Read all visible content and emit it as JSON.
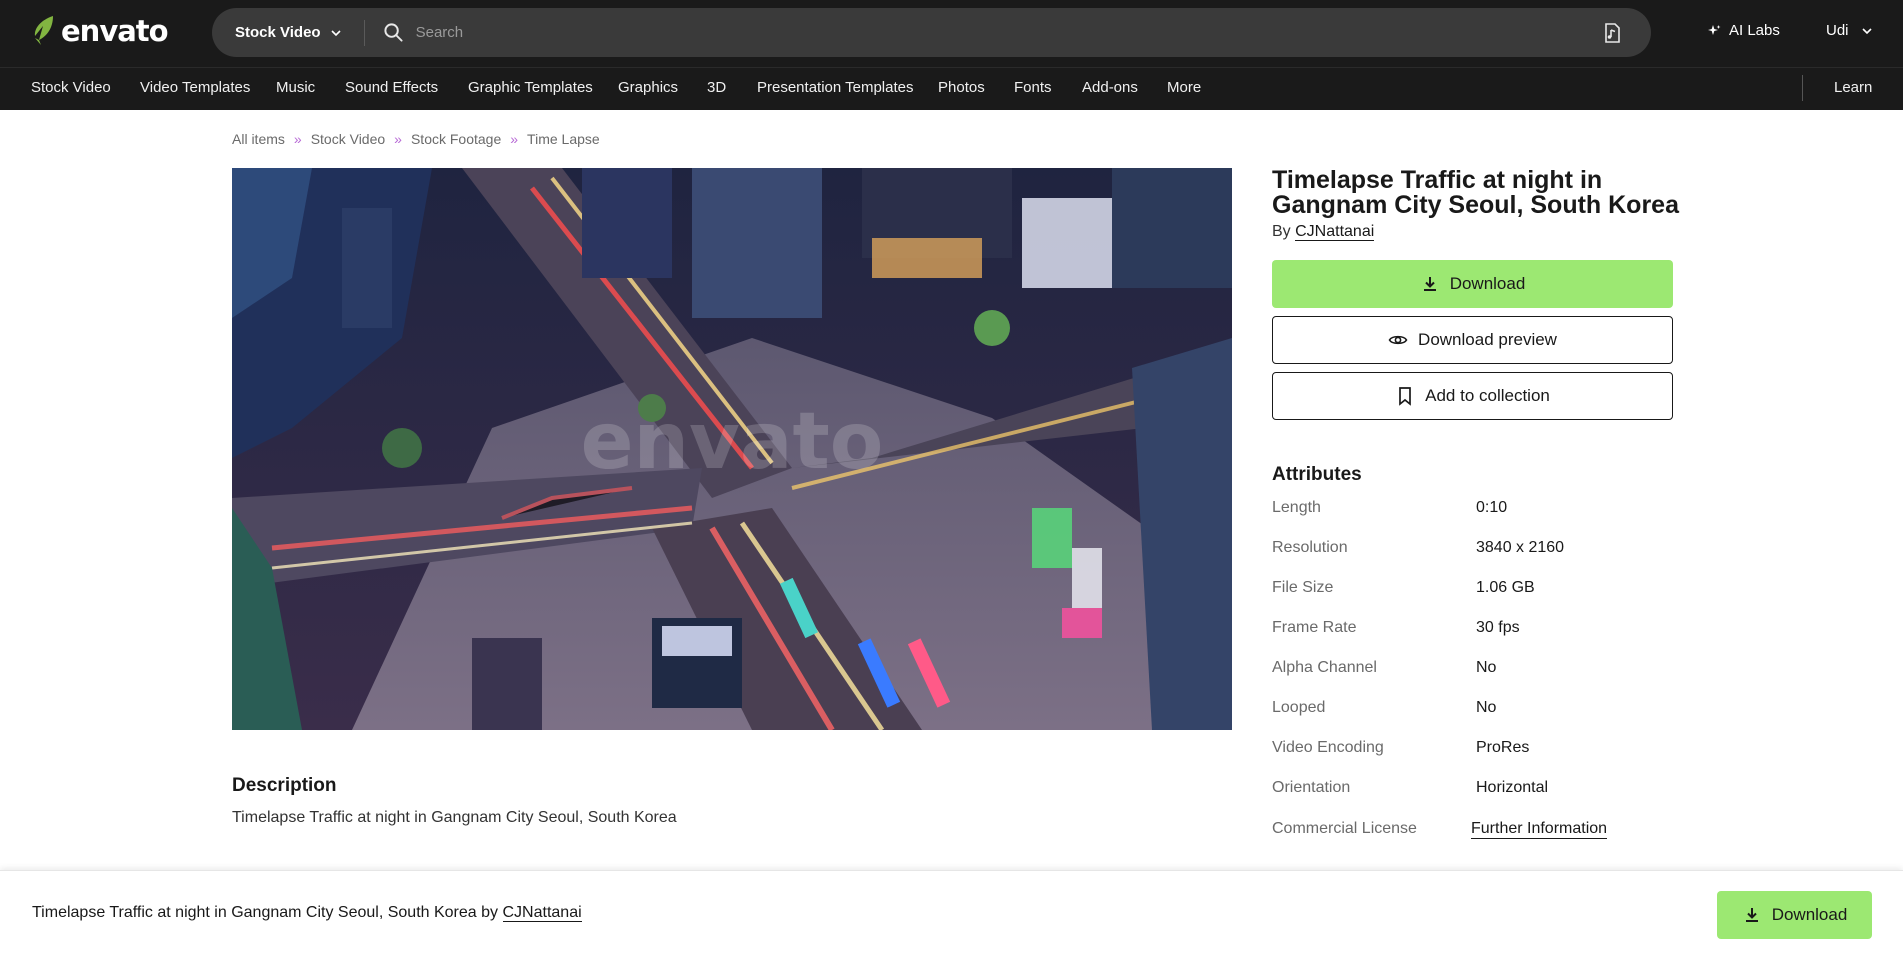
{
  "brand": {
    "name": "envato",
    "logo_icon": "envato-leaf-icon",
    "accent": "#9ce872",
    "logo_green": "#82b541"
  },
  "header": {
    "search": {
      "scope": "Stock Video",
      "placeholder": "Search"
    },
    "ai_labs": "AI Labs",
    "user": "Udi"
  },
  "categories": [
    "Stock Video",
    "Video Templates",
    "Music",
    "Sound Effects",
    "Graphic Templates",
    "Graphics",
    "3D",
    "Presentation Templates",
    "Photos",
    "Fonts",
    "Add-ons",
    "More"
  ],
  "learn": "Learn",
  "breadcrumb": [
    {
      "label": "All items"
    },
    {
      "label": "Stock Video"
    },
    {
      "label": "Stock Footage"
    },
    {
      "label": "Time Lapse"
    }
  ],
  "preview": {
    "watermark": "envato"
  },
  "item": {
    "title": "Timelapse Traffic at night in Gangnam City Seoul, South Korea",
    "by_prefix": "By",
    "author": "CJNattanai"
  },
  "actions": {
    "download": "Download",
    "download_preview": "Download preview",
    "add_to_collection": "Add to collection"
  },
  "attributes": {
    "heading": "Attributes",
    "rows": [
      {
        "label": "Length",
        "value": "0:10"
      },
      {
        "label": "Resolution",
        "value": "3840 x 2160"
      },
      {
        "label": "File Size",
        "value": "1.06 GB"
      },
      {
        "label": "Frame Rate",
        "value": "30 fps"
      },
      {
        "label": "Alpha Channel",
        "value": "No"
      },
      {
        "label": "Looped",
        "value": "No"
      },
      {
        "label": "Video Encoding",
        "value": "ProRes"
      },
      {
        "label": "Orientation",
        "value": "Horizontal"
      },
      {
        "label": "Commercial License",
        "value": "Further Information"
      }
    ]
  },
  "description": {
    "heading": "Description",
    "text": "Timelapse Traffic at night in Gangnam City Seoul, South Korea"
  },
  "sticky": {
    "title": "Timelapse Traffic at night in Gangnam City Seoul, South Korea",
    "by": "by",
    "author": "CJNattanai",
    "download": "Download"
  }
}
